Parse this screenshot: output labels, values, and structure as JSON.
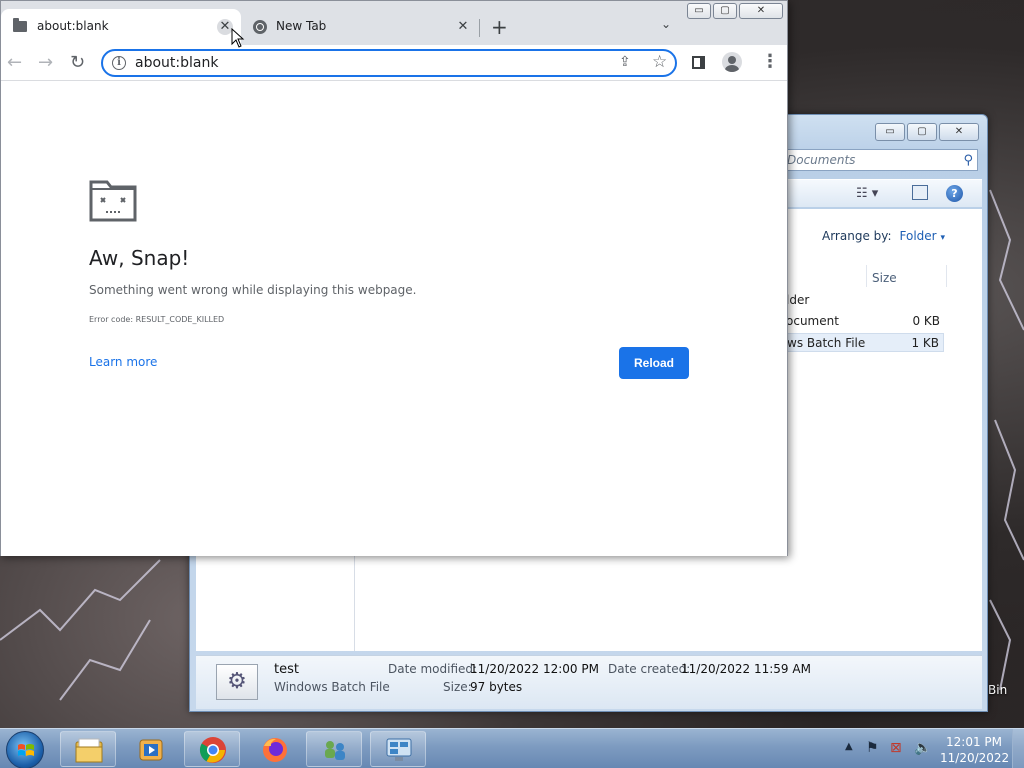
{
  "chrome": {
    "tabs": [
      {
        "title": "about:blank",
        "close": "✕"
      },
      {
        "title": "New Tab",
        "close": "✕"
      }
    ],
    "new_tab_glyph": "+",
    "tab_search_glyph": "⌄",
    "window_controls": {
      "minimize": "▭",
      "maximize": "▢",
      "close": "✕"
    },
    "toolbar": {
      "back": "←",
      "forward": "→",
      "reload": "↻"
    },
    "omnibox": {
      "info_glyph": "i",
      "url": "about:blank",
      "share_glyph": "⇪",
      "star_glyph": "☆"
    },
    "menu_glyph": "⋮",
    "error_page": {
      "title": "Aw, Snap!",
      "message": "Something went wrong while displaying this webpage.",
      "error_code": "Error code: RESULT_CODE_KILLED",
      "learn_more": "Learn more",
      "reload": "Reload"
    }
  },
  "explorer": {
    "controls": {
      "minimize": "▭",
      "maximize": "▢",
      "close": "✕"
    },
    "search_placeholder": "Documents",
    "search_glyph": "⚲",
    "view_glyph": "☷ ▾",
    "help_glyph": "?",
    "arrange_label": "Arrange by:",
    "arrange_value": "Folder",
    "arrange_caret": "▾",
    "columns": {
      "size": "Size"
    },
    "rows": [
      {
        "name": "lder",
        "size": ""
      },
      {
        "name": "ocument",
        "size": "0 KB"
      },
      {
        "name": "ws Batch File",
        "size": "1 KB",
        "selected": true
      }
    ],
    "details": {
      "file_name": "test",
      "file_type": "Windows Batch File",
      "date_modified_label": "Date modified:",
      "date_modified": "11/20/2022 12:00 PM",
      "date_created_label": "Date created:",
      "date_created": "11/20/2022 11:59 AM",
      "size_label": "Size:",
      "size": "97 bytes"
    }
  },
  "desktop": {
    "recycle_bin_label": "Bin"
  },
  "taskbar": {
    "apps": [
      "file-explorer",
      "media-player",
      "chrome",
      "firefox",
      "network-users",
      "remote-desktop"
    ],
    "tray_up": "▲",
    "clock_time": "12:01 PM",
    "clock_date": "11/20/2022"
  },
  "colors": {
    "accent": "#1a73e8",
    "tabstrip": "#dee1e6",
    "taskbar": "#7d9bc0"
  }
}
